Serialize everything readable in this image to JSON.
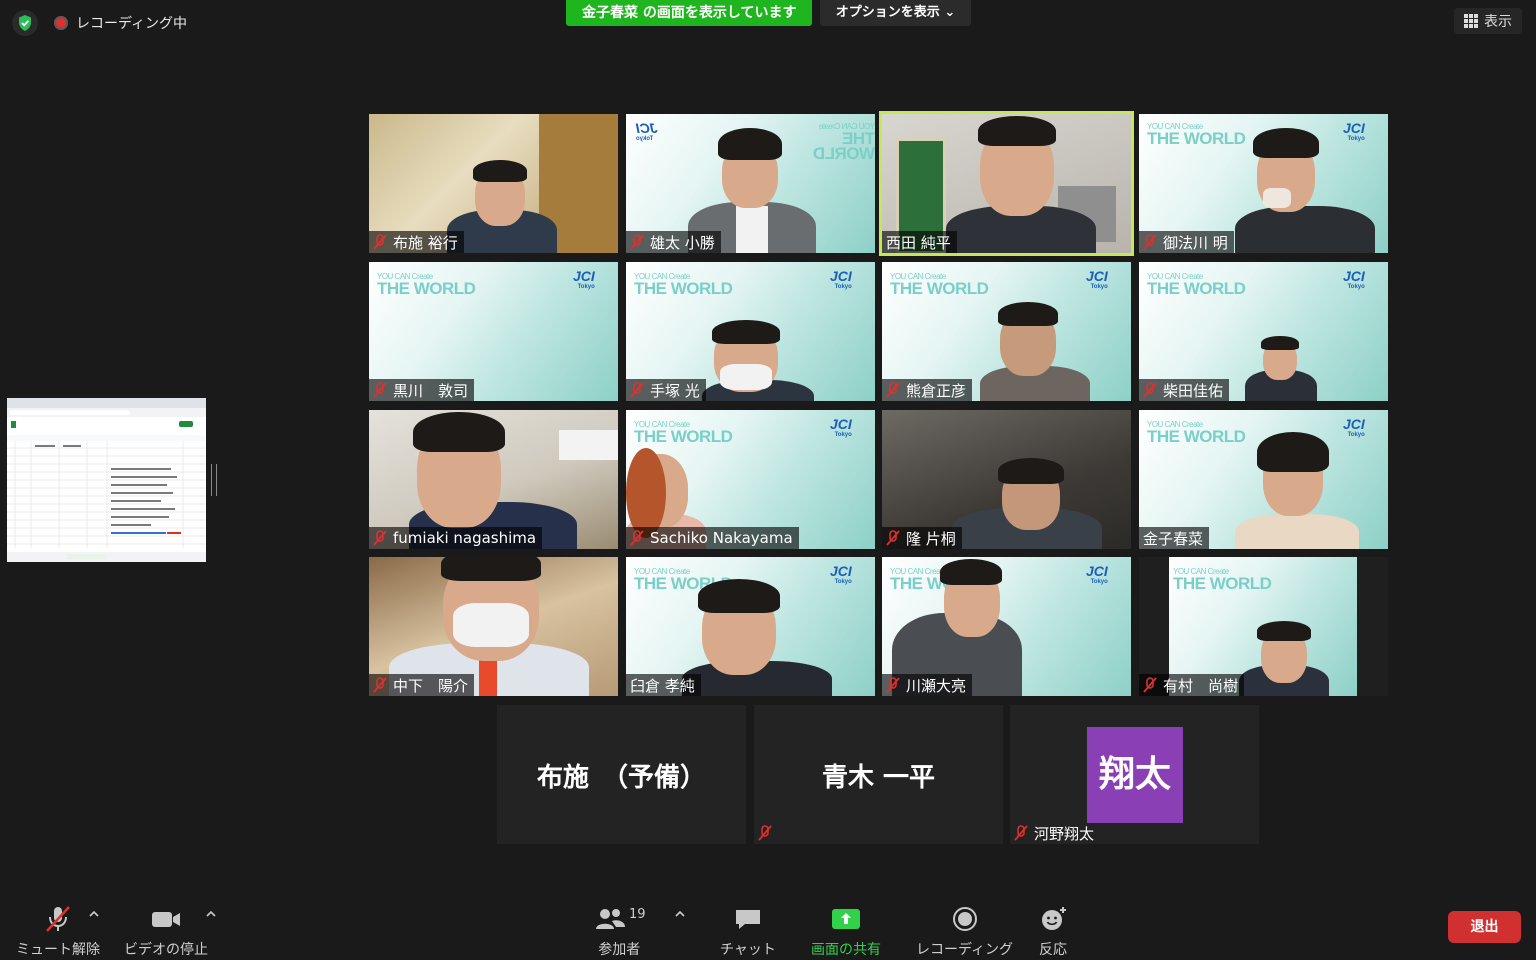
{
  "top": {
    "recording": "レコーディング中",
    "share_banner": "金子春菜 の画面を表示しています",
    "options": "オプションを表示",
    "view": "表示"
  },
  "tiles": [
    {
      "name": "布施 裕行",
      "muted": true
    },
    {
      "name": "雄太 小勝",
      "muted": true
    },
    {
      "name": "西田 純平",
      "muted": false,
      "active": true
    },
    {
      "name": "御法川 明",
      "muted": true
    },
    {
      "name": "黒川　敦司",
      "muted": true
    },
    {
      "name": "手塚 光",
      "muted": true
    },
    {
      "name": "熊倉正彦",
      "muted": true
    },
    {
      "name": "柴田佳佑",
      "muted": true
    },
    {
      "name": "fumiaki nagashima",
      "muted": true
    },
    {
      "name": "Sachiko Nakayama",
      "muted": true
    },
    {
      "name": "隆 片桐",
      "muted": true
    },
    {
      "name": "金子春菜",
      "muted": false
    },
    {
      "name": "中下　陽介",
      "muted": true
    },
    {
      "name": "臼倉 孝純",
      "muted": false
    },
    {
      "name": "川瀬大亮",
      "muted": true
    },
    {
      "name": "有村　尚樹",
      "muted": true
    }
  ],
  "jci": {
    "title_line1": "YOU CAN Create",
    "title_line2": "THE WORLD",
    "logo": "JCI",
    "logo_sub": "Tokyo"
  },
  "no_video": [
    {
      "display": "布施　（予備）",
      "name": ""
    },
    {
      "display": "青木 一平",
      "name": ""
    },
    {
      "avatar": "翔太",
      "name": "河野翔太"
    }
  ],
  "toolbar": {
    "unmute": "ミュート解除",
    "stop_video": "ビデオの停止",
    "participants": "参加者",
    "participants_count": "19",
    "chat": "チャット",
    "share": "画面の共有",
    "record": "レコーディング",
    "reactions": "反応",
    "leave": "退出"
  },
  "colors": {
    "share_green": "#1fb51f",
    "active_outline": "#c3e85a",
    "leave_red": "#d13030",
    "avatar_purple": "#8a3fb5"
  }
}
